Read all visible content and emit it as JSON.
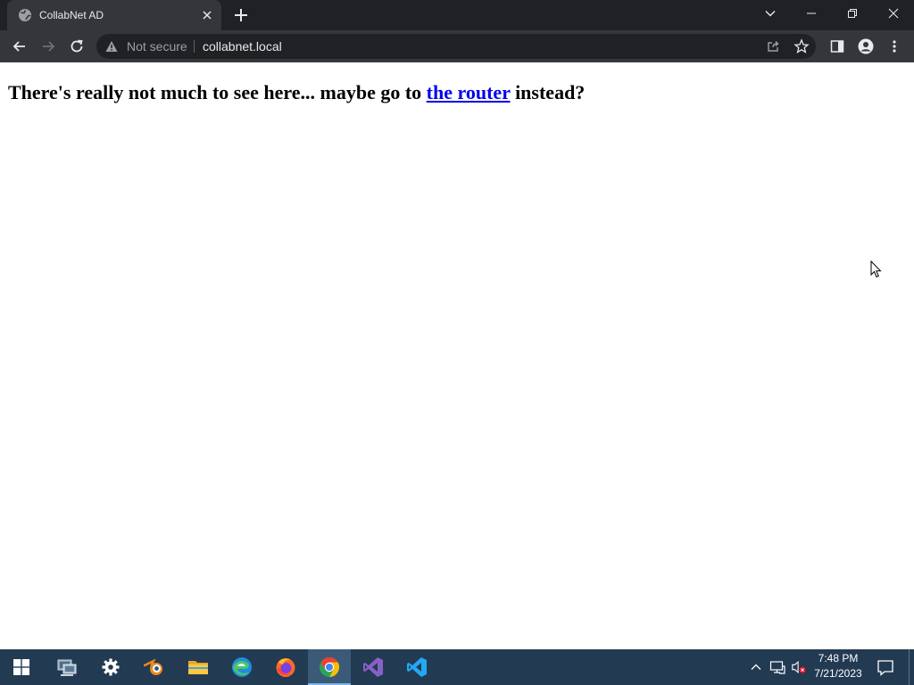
{
  "tab": {
    "title": "CollabNet AD"
  },
  "omnibox": {
    "security_label": "Not secure",
    "url": "collabnet.local"
  },
  "page": {
    "text_before": "There's really not much to see here... maybe go to ",
    "link_text": "the router",
    "text_after": " instead?"
  },
  "taskbar": {
    "apps": [
      "start",
      "network-admin",
      "settings",
      "blender",
      "file-explorer",
      "edge",
      "firefox",
      "chrome",
      "visual-studio",
      "vscode"
    ],
    "active_app": "chrome"
  },
  "clock": {
    "time": "7:48 PM",
    "date": "7/21/2023"
  },
  "colors": {
    "tab_strip": "#202124",
    "toolbar": "#35363a",
    "link": "#0000ee",
    "taskbar": "#233a53"
  }
}
